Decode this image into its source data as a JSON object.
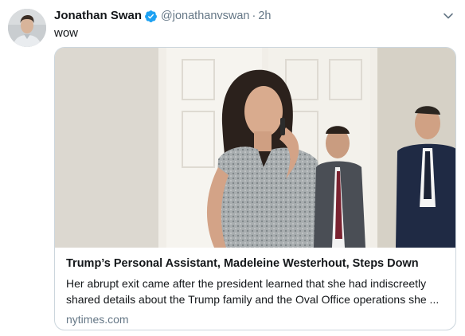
{
  "tweet": {
    "author": {
      "display_name": "Jonathan Swan",
      "handle": "@jonathanvswan",
      "verified_icon": "verified-badge-icon"
    },
    "separator": "·",
    "time": "2h",
    "text": "wow",
    "menu_icon": "chevron-down-icon"
  },
  "card": {
    "title": "Trump’s Personal Assistant, Madeleine Westerhout, Steps Down",
    "description": "Her abrupt exit came after the president learned that she had indiscreetly shared details about the Trump family and the Oval Office operations she ...",
    "domain": "nytimes.com"
  },
  "colors": {
    "verified": "#1da1f2",
    "secondary_text": "#657786",
    "border": "#ccd6dd"
  }
}
